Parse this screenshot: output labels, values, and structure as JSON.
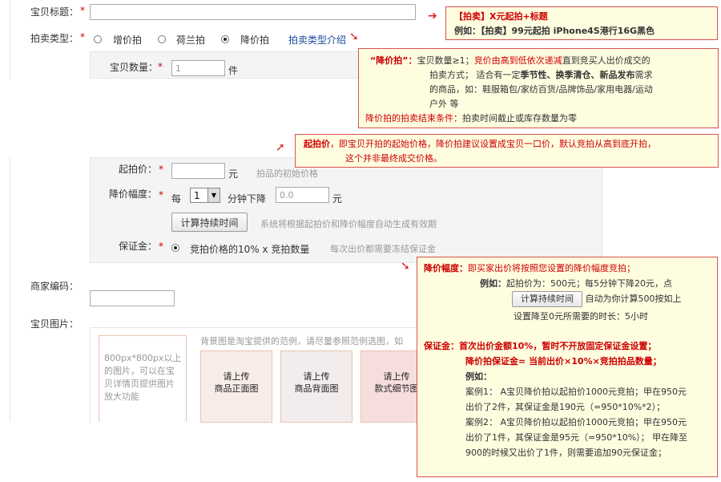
{
  "form": {
    "title_label": "宝贝标题：",
    "title_value": "",
    "type_label": "拍卖类型：",
    "type_options": [
      "增价拍",
      "荷兰拍",
      "降价拍"
    ],
    "type_intro_link": "拍卖类型介绍",
    "qty_label": "宝贝数量：",
    "qty_value": "1",
    "qty_unit": "件",
    "start_price_label": "起拍价：",
    "start_price_unit": "元",
    "start_price_hint": "拍品的初始价格",
    "drop_label": "降价幅度：",
    "drop_every": "每",
    "drop_minutes": "1",
    "drop_mid": "分钟下降",
    "drop_amount": "0.0",
    "drop_unit": "元",
    "calc_button": "计算持续时间",
    "calc_hint": "系统将根据起拍价和降价幅度自动生成有效期",
    "deposit_label": "保证金：",
    "deposit_option": "竞拍价格的10% x 竞拍数量",
    "deposit_hint": "每次出价都需要冻结保证金",
    "merchant_code_label": "商家编码：",
    "pictures_label": "宝贝图片：",
    "picture_upload_hint": "800px*800px以上的图片，可以在宝贝详情页提供图片放大功能",
    "picture_bg_hint": "背景图是淘宝提供的范例，请尽量参照范例选图，如",
    "picture_slots": [
      {
        "line1": "请上传",
        "line2": "商品正面图"
      },
      {
        "line1": "请上传",
        "line2": "商品背面图"
      },
      {
        "line1": "请上传",
        "line2": "款式细节图"
      }
    ],
    "required_mark": "*"
  },
  "tips": {
    "title_tip": {
      "line1_red": "【拍卖】",
      "line1_rest": "X元起拍+标题",
      "line2": "例如：【拍卖】99元起拍 iPhone4S港行16G黑色"
    },
    "dutch_tip": {
      "head": "“降价拍”：",
      "l1a": "宝贝数量≥1；",
      "l1b": "竞价由高到低依次递减",
      "l1c": "直到竞买人出价成交的",
      "l2a": "拍卖方式；  适合有一定",
      "l2b": "季节性、换季清仓、新品发布",
      "l2c": "需求",
      "l3": "的商品，如：鞋服箱包/家纺百货/品牌饰品/家用电器/运动",
      "l4": "户外 等",
      "l5a": "降价拍的拍卖结束条件：",
      "l5b": "拍卖时间截止或库存数量为零"
    },
    "start_tip": {
      "head": "起拍价",
      "l1": "，即宝贝开拍的起始价格，降价拍建议设置成宝贝一口价，默认竞拍从高到底开拍，",
      "l2": "这个并非最终成交价格。"
    },
    "drop_tip": {
      "head": "降价幅度：",
      "head_rest": "即买家出价将按照您设置的降价幅度竞拍；",
      "ex_label": "例如：",
      "ex1": "起拍价为：500元；每5分钟下降20元，点",
      "ex_button": "计算持续时间",
      "ex2": "自动为你计算500按如上",
      "ex3": "设置降至0元所需要的时长：5小时",
      "dep_head": "保证金：",
      "dep_rest": "首次出价金额10%，暂时不开放固定保证金设置；",
      "dep_formula": "降价拍保证金= 当前出价×10%×竞拍拍品数量；",
      "dep_ex": "例如：",
      "case1a": "案例1： A宝贝降价拍以起拍价1000元竞拍；甲在950元",
      "case1b": "出价了2件，其保证金是190元（=950*10%*2）；",
      "case2a": "案例2： A宝贝降价拍以起拍价1000元竞拍；甲在950元",
      "case2b": "出价了1件，其保证金是95元（=950*10%）； 甲在降至",
      "case2c": "900的时候又出价了1件，则需要追加90元保证金；"
    }
  },
  "colors": {
    "tip_bg": "#fffde0",
    "tip_border": "#d9534f",
    "accent_red": "#cc0000",
    "link_blue": "#1a4c9a"
  }
}
